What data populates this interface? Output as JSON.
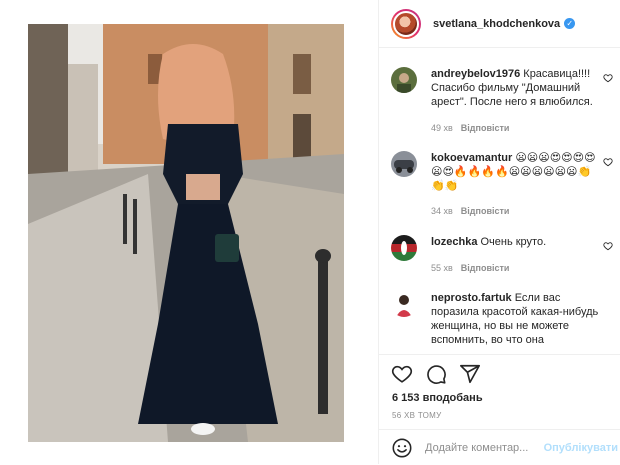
{
  "post": {
    "author": "svetlana_khodchenkova",
    "verified_mark": "✓",
    "likes": "6 153 вподобань",
    "time_ago": "56 ХВ ТОМУ"
  },
  "comments": [
    {
      "username": "andreybelov1976",
      "text": "Красавица!!!! Спасибо фильму \"Домашний арест\". После него я влюбился.",
      "time": "49 хв",
      "reply_label": "Відповісти"
    },
    {
      "username": "kokoevamantur",
      "text": "😦😦😦😍😍😍😍😦😍🔥🔥🔥🔥😦😦😦😦😦😦👏👏👏",
      "time": "34 хв",
      "reply_label": "Відповісти"
    },
    {
      "username": "lozechka",
      "text": "Очень круто.",
      "time": "55 хв",
      "reply_label": "Відповісти"
    },
    {
      "username": "neprosto.fartuk",
      "text": "Если вас поразила красотой какая-нибудь женщина, но вы не можете вспомнить, во что она",
      "time": "",
      "reply_label": ""
    }
  ],
  "composer": {
    "placeholder": "Додайте коментар...",
    "publish_label": "Опублікувати"
  },
  "icons": [
    "heart-icon",
    "comment-icon",
    "share-icon",
    "emoji-icon",
    "verified-icon"
  ],
  "colors": {
    "accent": "#3897f0",
    "publish_disabled": "#b2dffc",
    "meta_text": "#8e8e8e",
    "border": "#efefef"
  }
}
